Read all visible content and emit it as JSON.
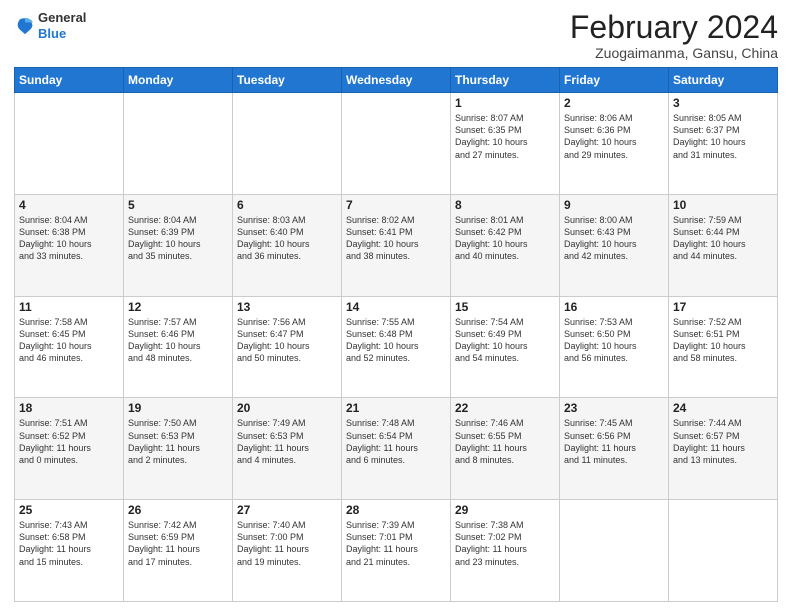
{
  "logo": {
    "general": "General",
    "blue": "Blue"
  },
  "header": {
    "month_year": "February 2024",
    "location": "Zuogaimanma, Gansu, China"
  },
  "days_of_week": [
    "Sunday",
    "Monday",
    "Tuesday",
    "Wednesday",
    "Thursday",
    "Friday",
    "Saturday"
  ],
  "weeks": [
    [
      {
        "day": "",
        "info": ""
      },
      {
        "day": "",
        "info": ""
      },
      {
        "day": "",
        "info": ""
      },
      {
        "day": "",
        "info": ""
      },
      {
        "day": "1",
        "info": "Sunrise: 8:07 AM\nSunset: 6:35 PM\nDaylight: 10 hours\nand 27 minutes."
      },
      {
        "day": "2",
        "info": "Sunrise: 8:06 AM\nSunset: 6:36 PM\nDaylight: 10 hours\nand 29 minutes."
      },
      {
        "day": "3",
        "info": "Sunrise: 8:05 AM\nSunset: 6:37 PM\nDaylight: 10 hours\nand 31 minutes."
      }
    ],
    [
      {
        "day": "4",
        "info": "Sunrise: 8:04 AM\nSunset: 6:38 PM\nDaylight: 10 hours\nand 33 minutes."
      },
      {
        "day": "5",
        "info": "Sunrise: 8:04 AM\nSunset: 6:39 PM\nDaylight: 10 hours\nand 35 minutes."
      },
      {
        "day": "6",
        "info": "Sunrise: 8:03 AM\nSunset: 6:40 PM\nDaylight: 10 hours\nand 36 minutes."
      },
      {
        "day": "7",
        "info": "Sunrise: 8:02 AM\nSunset: 6:41 PM\nDaylight: 10 hours\nand 38 minutes."
      },
      {
        "day": "8",
        "info": "Sunrise: 8:01 AM\nSunset: 6:42 PM\nDaylight: 10 hours\nand 40 minutes."
      },
      {
        "day": "9",
        "info": "Sunrise: 8:00 AM\nSunset: 6:43 PM\nDaylight: 10 hours\nand 42 minutes."
      },
      {
        "day": "10",
        "info": "Sunrise: 7:59 AM\nSunset: 6:44 PM\nDaylight: 10 hours\nand 44 minutes."
      }
    ],
    [
      {
        "day": "11",
        "info": "Sunrise: 7:58 AM\nSunset: 6:45 PM\nDaylight: 10 hours\nand 46 minutes."
      },
      {
        "day": "12",
        "info": "Sunrise: 7:57 AM\nSunset: 6:46 PM\nDaylight: 10 hours\nand 48 minutes."
      },
      {
        "day": "13",
        "info": "Sunrise: 7:56 AM\nSunset: 6:47 PM\nDaylight: 10 hours\nand 50 minutes."
      },
      {
        "day": "14",
        "info": "Sunrise: 7:55 AM\nSunset: 6:48 PM\nDaylight: 10 hours\nand 52 minutes."
      },
      {
        "day": "15",
        "info": "Sunrise: 7:54 AM\nSunset: 6:49 PM\nDaylight: 10 hours\nand 54 minutes."
      },
      {
        "day": "16",
        "info": "Sunrise: 7:53 AM\nSunset: 6:50 PM\nDaylight: 10 hours\nand 56 minutes."
      },
      {
        "day": "17",
        "info": "Sunrise: 7:52 AM\nSunset: 6:51 PM\nDaylight: 10 hours\nand 58 minutes."
      }
    ],
    [
      {
        "day": "18",
        "info": "Sunrise: 7:51 AM\nSunset: 6:52 PM\nDaylight: 11 hours\nand 0 minutes."
      },
      {
        "day": "19",
        "info": "Sunrise: 7:50 AM\nSunset: 6:53 PM\nDaylight: 11 hours\nand 2 minutes."
      },
      {
        "day": "20",
        "info": "Sunrise: 7:49 AM\nSunset: 6:53 PM\nDaylight: 11 hours\nand 4 minutes."
      },
      {
        "day": "21",
        "info": "Sunrise: 7:48 AM\nSunset: 6:54 PM\nDaylight: 11 hours\nand 6 minutes."
      },
      {
        "day": "22",
        "info": "Sunrise: 7:46 AM\nSunset: 6:55 PM\nDaylight: 11 hours\nand 8 minutes."
      },
      {
        "day": "23",
        "info": "Sunrise: 7:45 AM\nSunset: 6:56 PM\nDaylight: 11 hours\nand 11 minutes."
      },
      {
        "day": "24",
        "info": "Sunrise: 7:44 AM\nSunset: 6:57 PM\nDaylight: 11 hours\nand 13 minutes."
      }
    ],
    [
      {
        "day": "25",
        "info": "Sunrise: 7:43 AM\nSunset: 6:58 PM\nDaylight: 11 hours\nand 15 minutes."
      },
      {
        "day": "26",
        "info": "Sunrise: 7:42 AM\nSunset: 6:59 PM\nDaylight: 11 hours\nand 17 minutes."
      },
      {
        "day": "27",
        "info": "Sunrise: 7:40 AM\nSunset: 7:00 PM\nDaylight: 11 hours\nand 19 minutes."
      },
      {
        "day": "28",
        "info": "Sunrise: 7:39 AM\nSunset: 7:01 PM\nDaylight: 11 hours\nand 21 minutes."
      },
      {
        "day": "29",
        "info": "Sunrise: 7:38 AM\nSunset: 7:02 PM\nDaylight: 11 hours\nand 23 minutes."
      },
      {
        "day": "",
        "info": ""
      },
      {
        "day": "",
        "info": ""
      }
    ]
  ]
}
